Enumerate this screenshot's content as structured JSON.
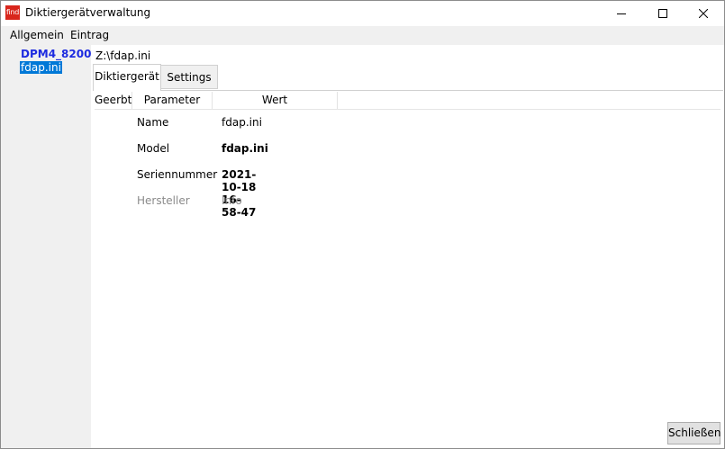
{
  "window": {
    "app_icon_text": "find",
    "title": "Diktiergerätverwaltung",
    "controls": [
      "minimize-icon",
      "maximize-icon",
      "close-icon"
    ]
  },
  "menu": {
    "items": [
      {
        "label": "Allgemein"
      },
      {
        "label": "Eintrag"
      }
    ]
  },
  "tree": {
    "root_label": "DPM4_8200",
    "child_label": "fdap.ini",
    "root_color": "#1d2be0",
    "selection_color": "#0078d7"
  },
  "main": {
    "path": "Z:\\fdap.ini",
    "tabs": [
      {
        "label": "Diktiergerät",
        "active": true
      },
      {
        "label": "Settings",
        "active": false
      }
    ],
    "columns": [
      "Geerbt",
      "Parameter",
      "Wert"
    ],
    "rows": [
      {
        "parameter": "Name",
        "value": "fdap.ini",
        "value_bold": false,
        "disabled": false
      },
      {
        "parameter": "Model",
        "value": "fdap.ini",
        "value_bold": true,
        "disabled": false
      },
      {
        "parameter": "Seriennummer",
        "value": "2021-10-18 16-58-47",
        "value_bold": true,
        "disabled": false
      },
      {
        "parameter": "Hersteller",
        "value": "Info",
        "value_bold": false,
        "disabled": true
      }
    ]
  },
  "footer": {
    "close_label": "Schließen"
  }
}
